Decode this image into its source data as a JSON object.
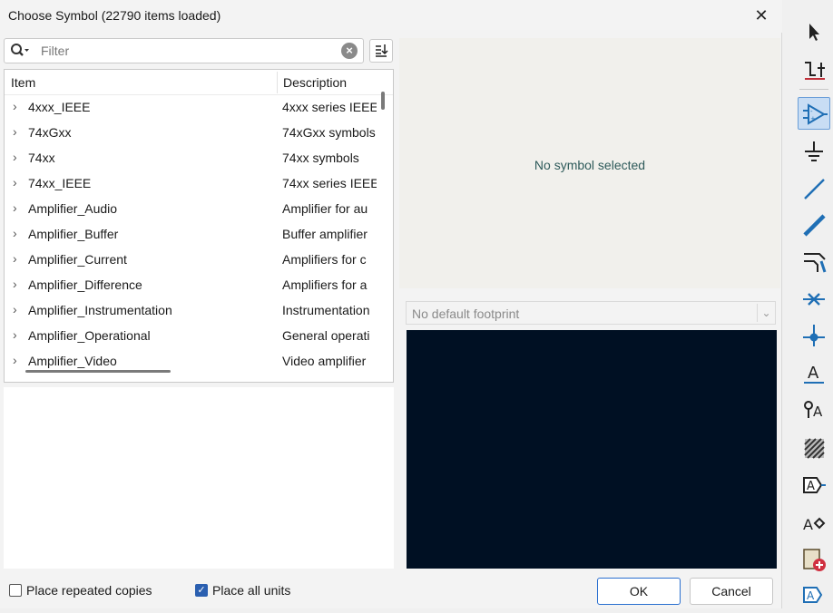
{
  "dialog": {
    "title": "Choose Symbol (22790 items loaded)",
    "close_glyph": "✕"
  },
  "filter": {
    "placeholder": "Filter",
    "value": ""
  },
  "tree": {
    "columns": [
      "Item",
      "Description"
    ],
    "rows": [
      {
        "name": "4xxx_IEEE",
        "desc": "4xxx series IEEE"
      },
      {
        "name": "74xGxx",
        "desc": "74xGxx symbols"
      },
      {
        "name": "74xx",
        "desc": "74xx symbols"
      },
      {
        "name": "74xx_IEEE",
        "desc": "74xx series IEEE"
      },
      {
        "name": "Amplifier_Audio",
        "desc": "Amplifier for au"
      },
      {
        "name": "Amplifier_Buffer",
        "desc": "Buffer amplifier"
      },
      {
        "name": "Amplifier_Current",
        "desc": "Amplifiers for c"
      },
      {
        "name": "Amplifier_Difference",
        "desc": "Amplifiers for a"
      },
      {
        "name": "Amplifier_Instrumentation",
        "desc": "Instrumentation"
      },
      {
        "name": "Amplifier_Operational",
        "desc": "General operati"
      },
      {
        "name": "Amplifier_Video",
        "desc": "Video amplifier"
      }
    ]
  },
  "preview": {
    "empty_text": "No symbol selected"
  },
  "footprint": {
    "selected": "No default footprint"
  },
  "options": {
    "place_repeated": {
      "label": "Place repeated copies",
      "checked": false
    },
    "place_all_units": {
      "label": "Place all units",
      "checked": true
    }
  },
  "buttons": {
    "ok": "OK",
    "cancel": "Cancel"
  },
  "right_toolbar": {
    "icons": [
      "select-arrow-icon",
      "pin-to-pin-icon",
      "add-symbol-icon",
      "add-power-icon",
      "add-wire-icon",
      "add-bus-icon",
      "bus-entry-icon",
      "no-connect-icon",
      "junction-icon",
      "net-label-icon",
      "global-label-icon",
      "hatched-sheet-icon",
      "hierarchical-label-icon",
      "label-pin-icon",
      "add-sheet-icon",
      "sheet-pin-icon"
    ]
  },
  "colors": {
    "accent": "#2a5fb0",
    "footprint_canvas": "#001023",
    "preview_bg": "#f1f0ec",
    "no_symbol_text": "#2e5a5a"
  }
}
